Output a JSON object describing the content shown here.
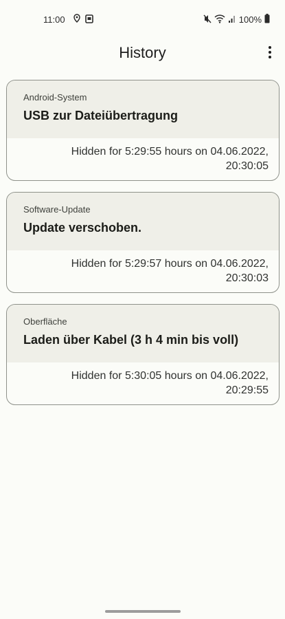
{
  "status_bar": {
    "time": "11:00",
    "battery": "100%",
    "left_icons": [
      "location-pin-icon",
      "screenshot-icon"
    ],
    "right_icons": [
      "mute-icon",
      "wifi-icon",
      "signal-icon",
      "battery-icon"
    ]
  },
  "app_bar": {
    "title": "History",
    "menu_icon": "overflow-menu-icon"
  },
  "history": {
    "items": [
      {
        "app": "Android-System",
        "title": "USB zur Dateiübertragung",
        "hidden_line1": "Hidden for 5:29:55 hours on 04.06.2022,",
        "hidden_line2": "20:30:05"
      },
      {
        "app": "Software-Update",
        "title": "Update verschoben.",
        "hidden_line1": "Hidden for 5:29:57 hours on 04.06.2022,",
        "hidden_line2": "20:30:03"
      },
      {
        "app": "Oberfläche",
        "title": "Laden über Kabel (3 h 4 min bis voll)",
        "hidden_line1": "Hidden for 5:30:05 hours on 04.06.2022,",
        "hidden_line2": "20:29:55"
      }
    ]
  },
  "colors": {
    "background": "#fbfcf8",
    "card_header": "#efefe8",
    "card_border": "#8e918a"
  }
}
